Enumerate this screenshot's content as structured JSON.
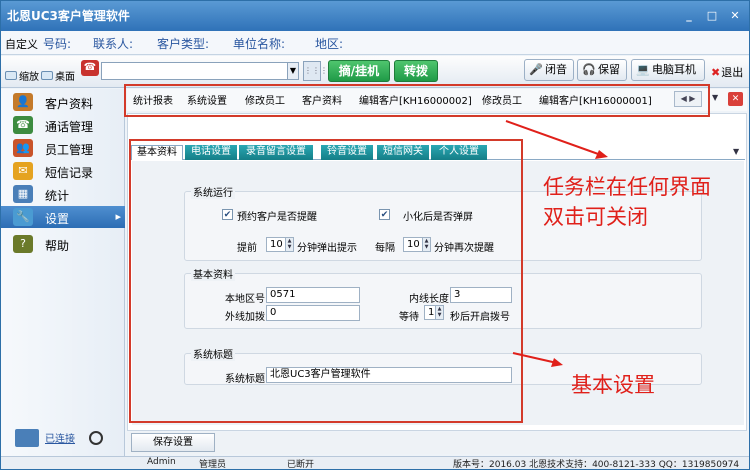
{
  "window": {
    "title": "北恩UC3客户管理软件"
  },
  "info_bar": {
    "custom": "自定义",
    "fields": [
      "号码:",
      "联系人:",
      "客户类型:",
      "单位名称:",
      "地区:"
    ]
  },
  "toolbar": {
    "minimize_label": "缩放",
    "desktop_label": "桌面",
    "dial_label": "摘/挂机",
    "transfer_label": "转拨",
    "mute_label": "闭音",
    "hold_label": "保留",
    "headset_label": "电脑耳机",
    "exit_label": "退出"
  },
  "sidebar": {
    "items": [
      {
        "label": "客户资料",
        "icon": "customer-icon",
        "color": "#c47a2a"
      },
      {
        "label": "通话管理",
        "icon": "call-log-icon",
        "color": "#3d8c40"
      },
      {
        "label": "员工管理",
        "icon": "staff-icon",
        "color": "#c9542a"
      },
      {
        "label": "短信记录",
        "icon": "sms-icon",
        "color": "#e5a320"
      },
      {
        "label": "统计",
        "icon": "stats-icon",
        "color": "#4a7fb8"
      },
      {
        "label": "设置",
        "icon": "settings-icon",
        "color": "#4a9bd2"
      },
      {
        "label": "帮助",
        "icon": "help-icon",
        "color": "#6b7a2a"
      }
    ],
    "active_index": 5,
    "connection_status": "已连接"
  },
  "task_tabs": [
    "统计报表",
    "系统设置",
    "修改员工",
    "客户资料",
    "编辑客户[KH16000002]",
    "修改员工",
    "编辑客户[KH16000001]"
  ],
  "sub_tabs": [
    "基本资料",
    "电话设置",
    "录音留言设置",
    "铃音设置",
    "短信网关",
    "个人设置"
  ],
  "system_run": {
    "title": "系统运行",
    "reminder_label": "预约客户是否提醒",
    "popup_label": "小化后是否弹屏",
    "before_label": "提前",
    "before_value": "10",
    "before_unit": "分钟弹出提示",
    "interval_label": "每隔",
    "interval_value": "10",
    "interval_unit": "分钟再次提醒"
  },
  "basic_info": {
    "title": "基本资料",
    "area_code_label": "本地区号",
    "area_code_value": "0571",
    "line_length_label": "内线长度",
    "line_length_value": "3",
    "outside_prefix_label": "外线加拨",
    "outside_prefix_value": "0",
    "wait_label": "等待",
    "wait_value": "1",
    "wait_unit": "秒后开启拨号"
  },
  "system_title": {
    "title": "系统标题",
    "label": "系统标题",
    "value": "北恩UC3客户管理软件"
  },
  "annotations": {
    "taskbar_note_line1": "任务栏在任何界面",
    "taskbar_note_line2": "双击可关闭",
    "basic_settings_note": "基本设置"
  },
  "save_button": "保存设置",
  "status_bar": {
    "user": "Admin",
    "role": "管理员",
    "connection": "已断开",
    "version": "版本号：2016.03 北恩技术支持：400-8121-333 QQ：1319850974"
  }
}
